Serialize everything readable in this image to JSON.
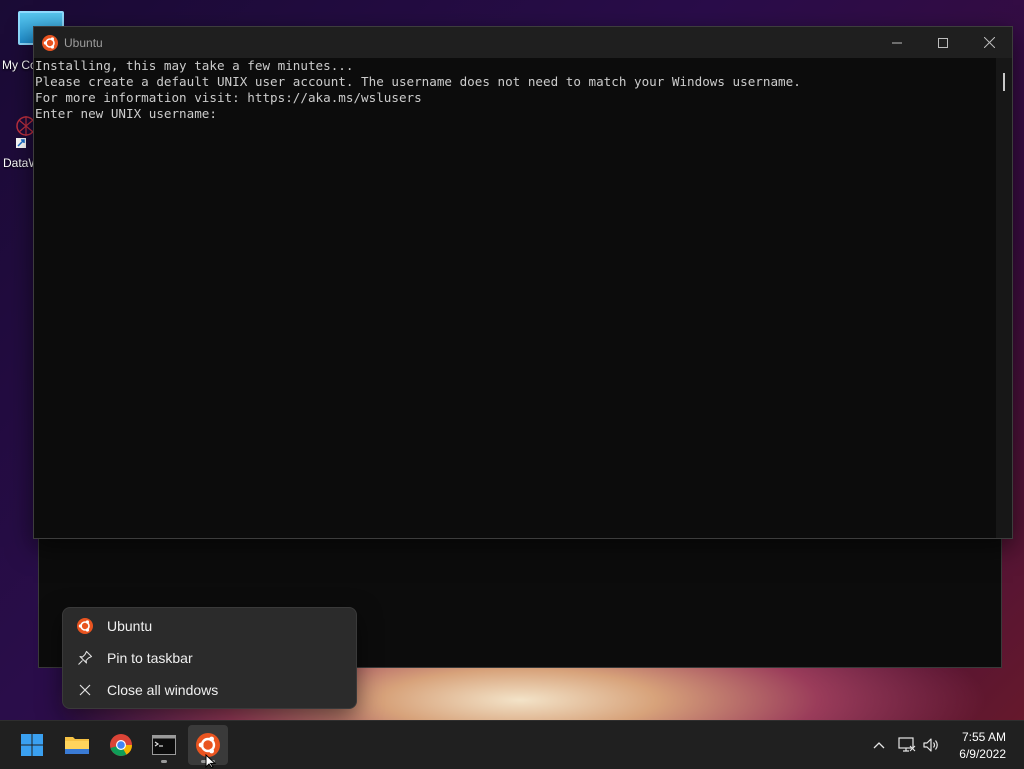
{
  "desktop": {
    "icons": [
      {
        "label": "My Computer",
        "icon": "computer-icon"
      },
      {
        "label": "DataWarrior",
        "icon": "datawarrior-icon"
      }
    ]
  },
  "window": {
    "title": "Ubuntu",
    "icon": "ubuntu-icon",
    "controls": {
      "minimize": "—",
      "maximize": "☐",
      "close": "✕"
    },
    "console_lines": [
      "Installing, this may take a few minutes...",
      "Please create a default UNIX user account. The username does not need to match your Windows username.",
      "For more information visit: https://aka.ms/wslusers",
      "Enter new UNIX username: "
    ]
  },
  "jumplist": {
    "items": [
      {
        "label": "Ubuntu",
        "icon": "ubuntu-icon"
      },
      {
        "label": "Pin to taskbar",
        "icon": "pin-icon"
      },
      {
        "label": "Close all windows",
        "icon": "close-icon"
      }
    ]
  },
  "taskbar": {
    "apps": [
      {
        "name": "Start",
        "icon": "windows-start-icon"
      },
      {
        "name": "File Explorer",
        "icon": "folder-icon"
      },
      {
        "name": "Google Chrome",
        "icon": "chrome-icon"
      },
      {
        "name": "Terminal",
        "icon": "terminal-icon"
      },
      {
        "name": "Ubuntu",
        "icon": "ubuntu-icon",
        "active": true
      }
    ],
    "tray": {
      "icons": [
        "chevron-up-icon",
        "network-icon",
        "volume-icon"
      ],
      "time": "7:55 AM",
      "date": "6/9/2022"
    }
  },
  "colors": {
    "ubuntu_orange": "#e95420",
    "console_bg": "#0c0c0c",
    "console_text": "#cccccc",
    "taskbar_bg": "#202020",
    "menu_bg": "#2b2b2b"
  }
}
